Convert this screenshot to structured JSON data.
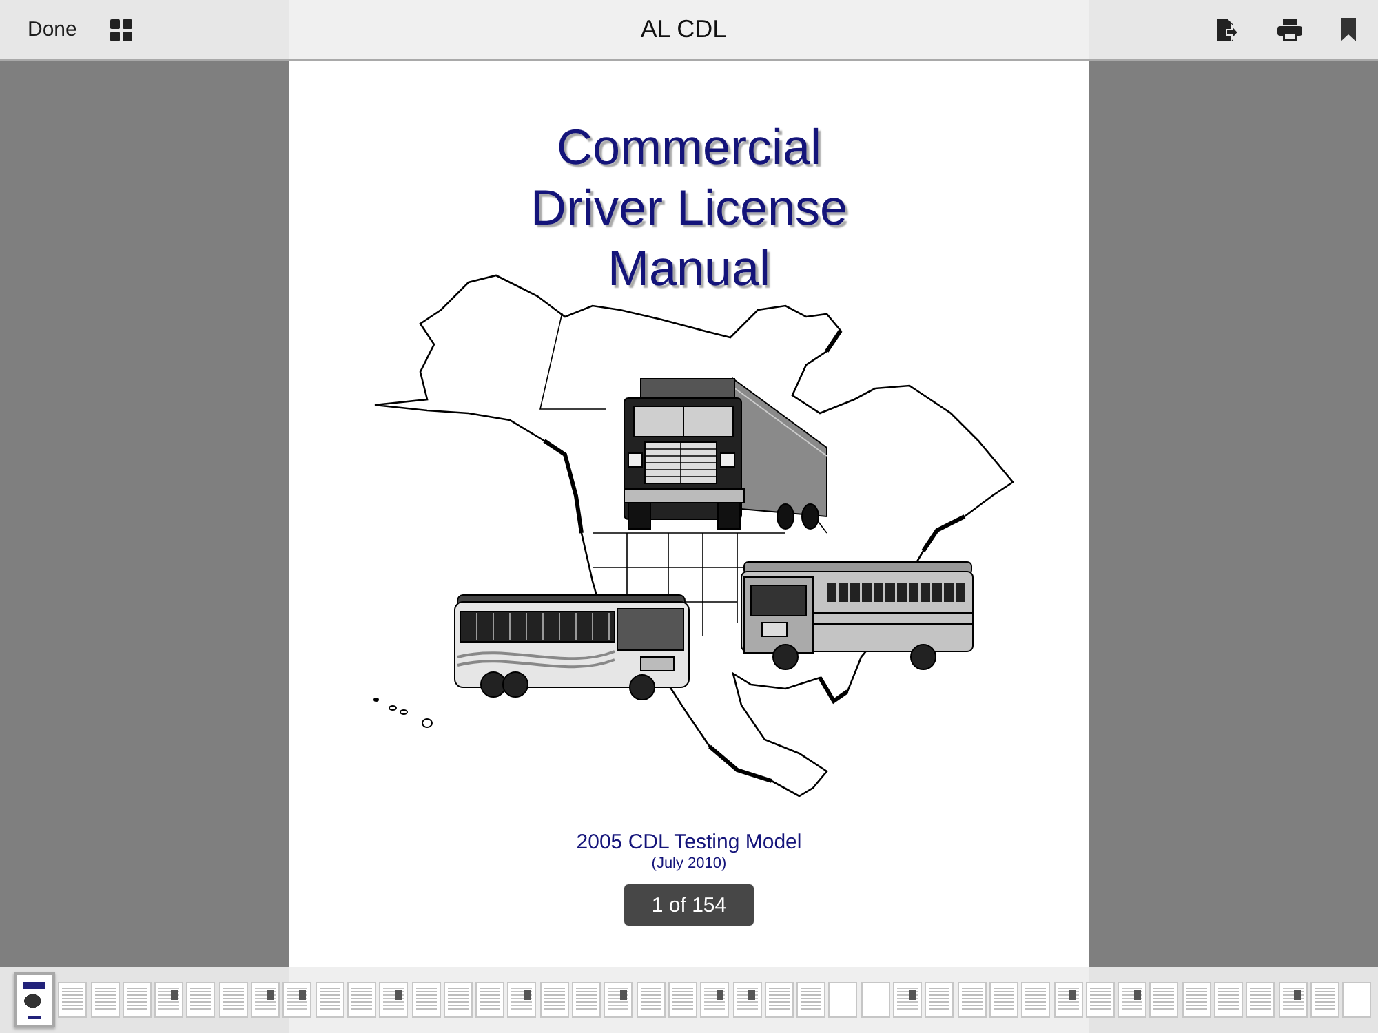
{
  "toolbar": {
    "done_button": "Done",
    "title": "AL CDL"
  },
  "page": {
    "title": "Commercial Driver License Manual",
    "subtitle": "2005 CDL Testing Model",
    "date": "(July 2010)"
  },
  "page_indicator": "1 of 154",
  "thumbnails": [
    {
      "kind": "cover",
      "selected": true
    },
    {
      "kind": "text",
      "selected": false
    },
    {
      "kind": "text",
      "selected": false
    },
    {
      "kind": "text",
      "selected": false
    },
    {
      "kind": "figure",
      "selected": false
    },
    {
      "kind": "text",
      "selected": false
    },
    {
      "kind": "text",
      "selected": false
    },
    {
      "kind": "figure",
      "selected": false
    },
    {
      "kind": "figure",
      "selected": false
    },
    {
      "kind": "text",
      "selected": false
    },
    {
      "kind": "text",
      "selected": false
    },
    {
      "kind": "figure",
      "selected": false
    },
    {
      "kind": "text",
      "selected": false
    },
    {
      "kind": "text",
      "selected": false
    },
    {
      "kind": "text",
      "selected": false
    },
    {
      "kind": "figure",
      "selected": false
    },
    {
      "kind": "text",
      "selected": false
    },
    {
      "kind": "text",
      "selected": false
    },
    {
      "kind": "figure",
      "selected": false
    },
    {
      "kind": "text",
      "selected": false
    },
    {
      "kind": "text",
      "selected": false
    },
    {
      "kind": "figure",
      "selected": false
    },
    {
      "kind": "figure",
      "selected": false
    },
    {
      "kind": "text",
      "selected": false
    },
    {
      "kind": "text",
      "selected": false
    },
    {
      "kind": "blank",
      "selected": false
    },
    {
      "kind": "blank",
      "selected": false
    },
    {
      "kind": "figure",
      "selected": false
    },
    {
      "kind": "text",
      "selected": false
    },
    {
      "kind": "text",
      "selected": false
    },
    {
      "kind": "text",
      "selected": false
    },
    {
      "kind": "text",
      "selected": false
    },
    {
      "kind": "figure",
      "selected": false
    },
    {
      "kind": "text",
      "selected": false
    },
    {
      "kind": "figure",
      "selected": false
    },
    {
      "kind": "text",
      "selected": false
    },
    {
      "kind": "text",
      "selected": false
    },
    {
      "kind": "text",
      "selected": false
    },
    {
      "kind": "text",
      "selected": false
    },
    {
      "kind": "figure",
      "selected": false
    },
    {
      "kind": "text",
      "selected": false
    },
    {
      "kind": "blank",
      "selected": false
    }
  ]
}
